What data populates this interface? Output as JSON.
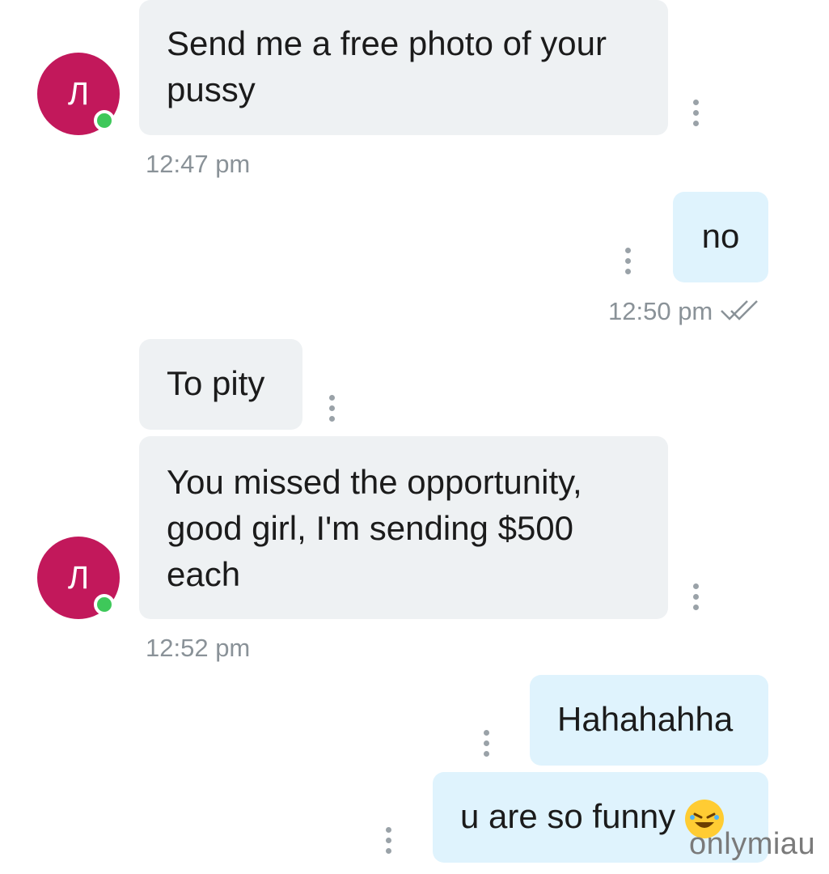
{
  "contact": {
    "avatar_initial": "Л",
    "avatar_color": "#c2185b",
    "online_color": "#3ec85a"
  },
  "messages": [
    {
      "direction": "in",
      "text": "Send me a free photo of your pussy",
      "time": "12:47 pm"
    },
    {
      "direction": "out",
      "text": "no",
      "time": "12:50 pm",
      "status_icon": "double-check-icon"
    },
    {
      "direction": "in",
      "text": "To pity"
    },
    {
      "direction": "in",
      "text": "You missed the opportunity, good girl, I'm sending $500 each",
      "time": "12:52 pm"
    },
    {
      "direction": "out",
      "text": "Hahahahha"
    },
    {
      "direction": "out",
      "text": "u are so funny",
      "emoji": "rolling-on-floor-laughing-emoji"
    }
  ],
  "watermark": "onlymiau",
  "colors": {
    "incoming_bubble": "#eef1f3",
    "outgoing_bubble": "#dff3fd",
    "timestamp": "#8a9298"
  }
}
